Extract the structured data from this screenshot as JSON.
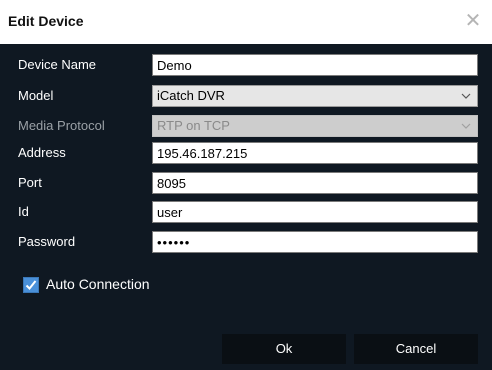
{
  "dialog": {
    "title": "Edit Device",
    "close_glyph": "✕"
  },
  "fields": {
    "device_name": {
      "label": "Device Name",
      "value": "Demo"
    },
    "model": {
      "label": "Model",
      "value": "iCatch DVR"
    },
    "media_protocol": {
      "label": "Media Protocol",
      "value": "RTP on TCP",
      "disabled": true
    },
    "address": {
      "label": "Address",
      "value": "195.46.187.215"
    },
    "port": {
      "label": "Port",
      "value": "8095"
    },
    "id": {
      "label": "Id",
      "value": "user"
    },
    "password": {
      "label": "Password",
      "value": "••••••"
    }
  },
  "auto_connection": {
    "label": "Auto Connection",
    "checked": true
  },
  "buttons": {
    "ok": "Ok",
    "cancel": "Cancel"
  },
  "colors": {
    "background": "#0f1822",
    "titlebar": "#ffffff",
    "checkbox_accent": "#4a90d9",
    "button": "#0a0f14"
  },
  "icons": {
    "close": "close-icon",
    "dropdown": "chevron-down-icon",
    "check": "checkmark-icon"
  }
}
